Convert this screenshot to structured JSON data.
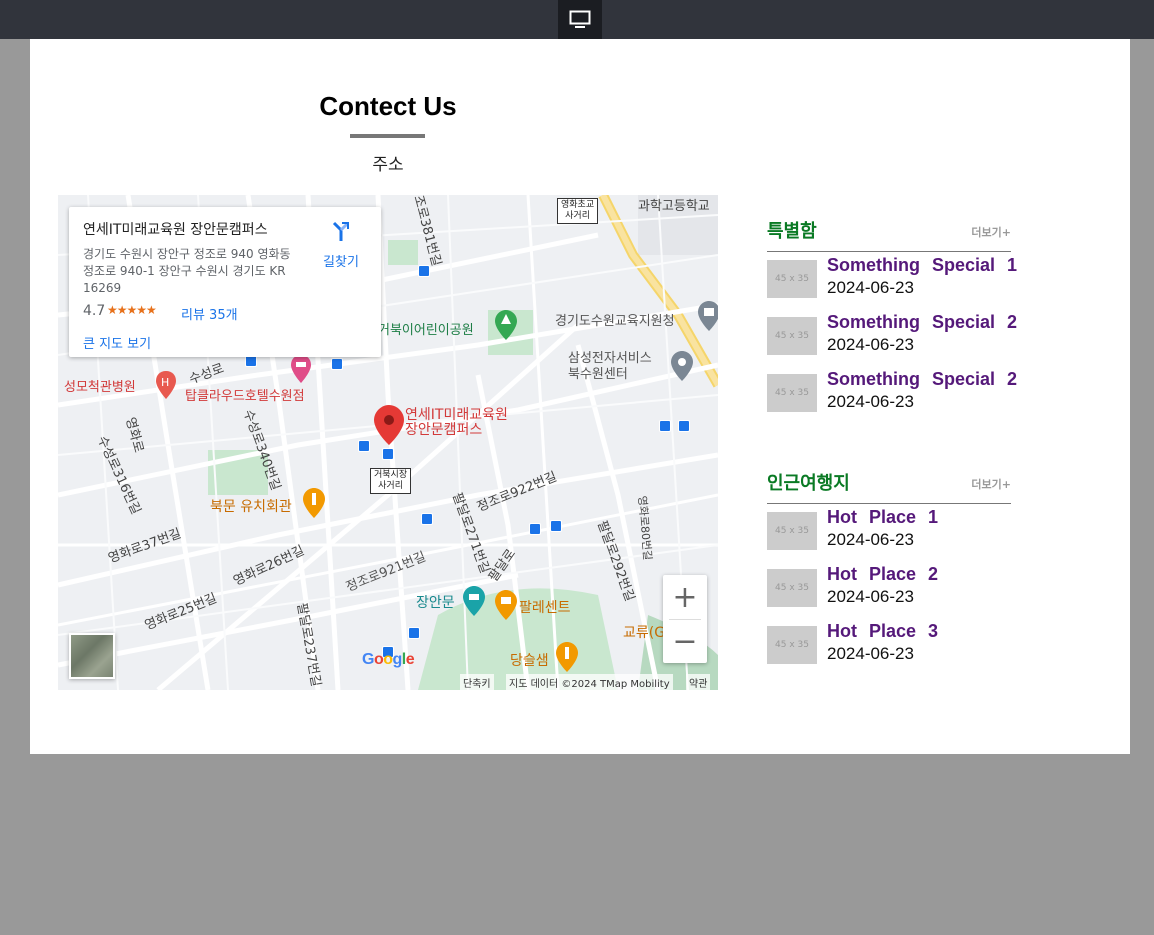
{
  "toolbar": {
    "device_icon": "monitor-icon"
  },
  "page": {
    "title": "Contect Us",
    "subtitle": "주소"
  },
  "map": {
    "info": {
      "name": "연세IT미래교육원 장안문캠퍼스",
      "address": "경기도 수원시 장안구 정조로 940 영화동 정조로 940-1 장안구 수원시 경기도 KR 16269",
      "rating": "4.7",
      "stars": "★★★★★",
      "reviews": "리뷰 35개",
      "directions": "길찾기",
      "larger_map": "큰 지도 보기"
    },
    "labels": {
      "school": "과학고등학교",
      "ext_top": "영화초교\n사거리",
      "park": "거북이어린이공원",
      "office": "경기도수원교육지원청",
      "samsung": "삼성전자서비스\n북수원센터",
      "hospital": "성모척관병원",
      "hotel": "탑클라우드호텔수원점",
      "suseongro": "수성로",
      "pin": "연세IT미래교육원\n장안문캠퍼스",
      "market": "거북시장\n사거리",
      "restaurant": "북문 유치회관",
      "jeongjo922": "정조로922번길",
      "yeonghwa37": "영화로37번길",
      "yeonghwa26": "영화로26번길",
      "yeonghwa25": "영화로25번길",
      "jeongjo921": "정조로921번길",
      "paldal271": "팔달로271번길",
      "paldal292": "팔달로292번길",
      "paldal237": "팔달로237번길",
      "paldalro": "팔달로",
      "janganmun": "장안문",
      "palace": "팔레센트",
      "gyoryu": "교류(G",
      "dangsulsaem": "당슬샘",
      "suseong316": "수성로316번길",
      "suseong340": "수성로340번길",
      "yeonghwaro": "영화로",
      "jeongjo381": "정조로381번길",
      "yeonghwa80": "영화로80번길"
    },
    "google": "Google",
    "attribution": {
      "shortcuts": "단축키",
      "data": "지도 데이터 ©2024 TMap Mobility",
      "terms": "약관"
    },
    "zoom_in": "+",
    "zoom_out": "−"
  },
  "special": {
    "title": "특별함",
    "more": "더보기+",
    "items": [
      {
        "thumb": "45 x 35",
        "title": "Something Special 1",
        "date": "2024-06-23"
      },
      {
        "thumb": "45 x 35",
        "title": "Something Special 2",
        "date": "2024-06-23"
      },
      {
        "thumb": "45 x 35",
        "title": "Something Special 2",
        "date": "2024-06-23"
      }
    ]
  },
  "nearby": {
    "title": "인근여행지",
    "more": "더보기+",
    "items": [
      {
        "thumb": "45 x 35",
        "title": "Hot Place 1",
        "date": "2024-06-23"
      },
      {
        "thumb": "45 x 35",
        "title": "Hot Place 2",
        "date": "2024-06-23"
      },
      {
        "thumb": "45 x 35",
        "title": "Hot Place 3",
        "date": "2024-06-23"
      }
    ]
  },
  "colors": {
    "accent_green": "#0a7a24",
    "item_purple": "#55197a",
    "topbar": "#31343c"
  }
}
